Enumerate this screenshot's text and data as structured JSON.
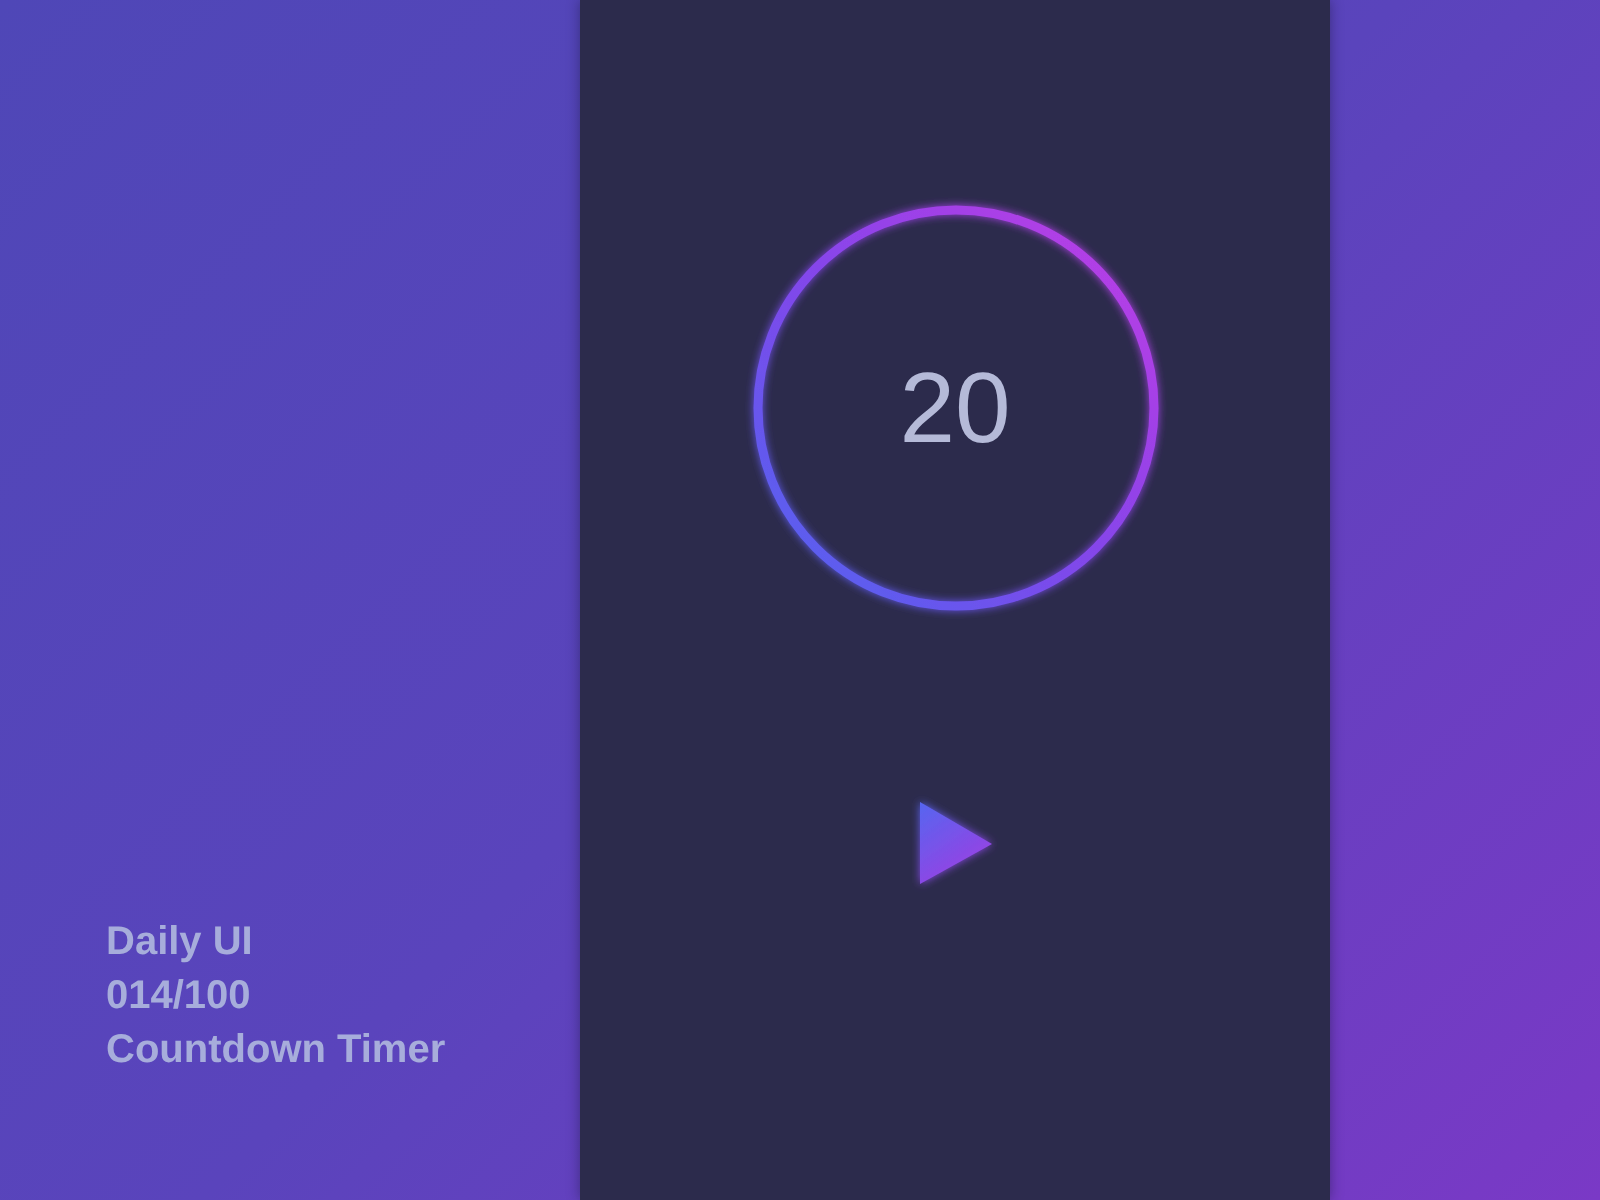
{
  "timer": {
    "remaining": "20"
  },
  "caption": {
    "lines": [
      "Daily UI",
      "014/100",
      "Countdown Timer"
    ]
  }
}
